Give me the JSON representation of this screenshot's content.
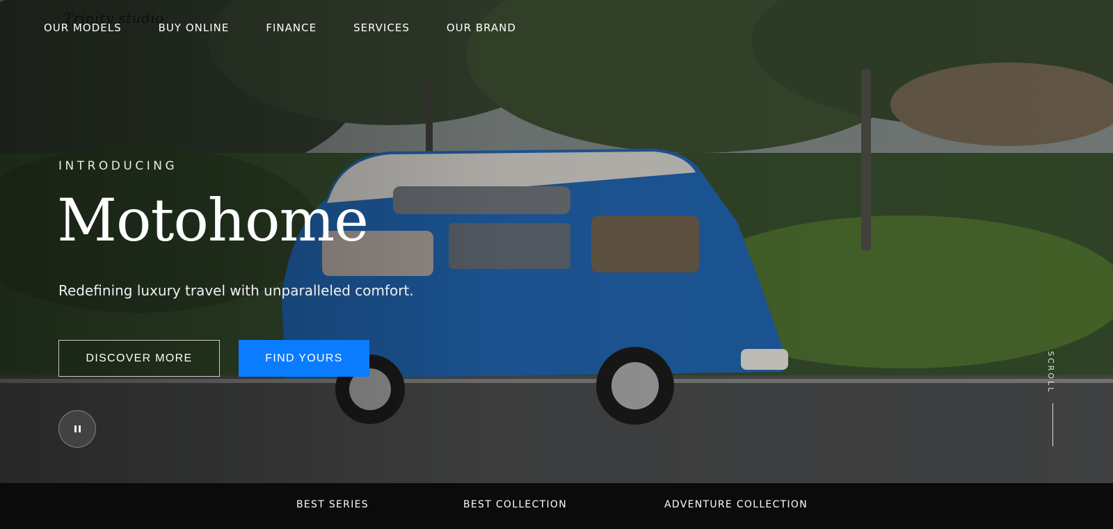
{
  "brand": {
    "logo_text": "Trinity studio",
    "primary_color": "#0a7cff"
  },
  "nav": {
    "items": [
      "OUR MODELS",
      "BUY ONLINE",
      "FINANCE",
      "SERVICES",
      "OUR BRAND"
    ]
  },
  "hero": {
    "eyebrow": "INTRODUCING",
    "title": "Motohome",
    "tagline": "Redefining luxury travel with unparalleled comfort.",
    "discover_label": "DISCOVER MORE",
    "find_label": "FIND YOURS",
    "pause_icon": "pause-icon",
    "scroll_label": "SCROLL"
  },
  "collections": {
    "items": [
      "BEST SERIES",
      "BEST COLLECTION",
      "ADVENTURE COLLECTION"
    ]
  }
}
